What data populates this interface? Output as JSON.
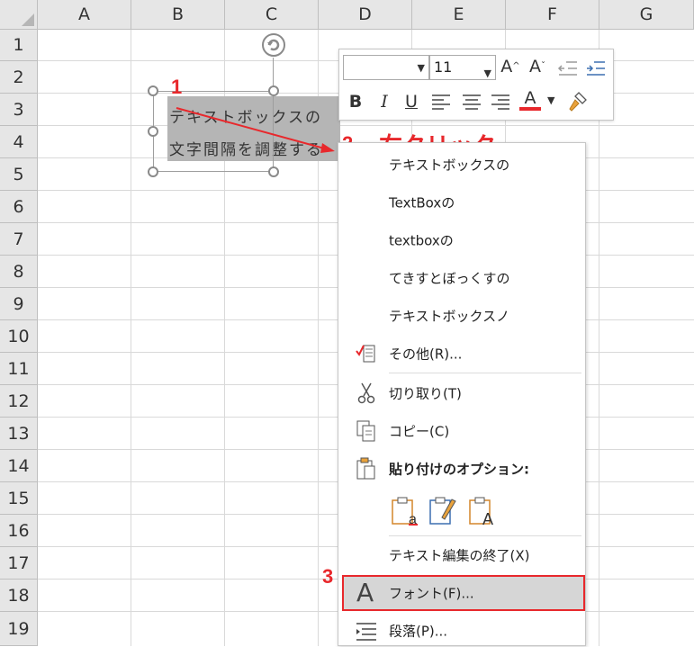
{
  "columns": [
    "A",
    "B",
    "C",
    "D",
    "E",
    "F",
    "G"
  ],
  "rows": [
    "1",
    "2",
    "3",
    "4",
    "5",
    "6",
    "7",
    "8",
    "9",
    "10",
    "11",
    "12",
    "13",
    "14",
    "15",
    "16",
    "17",
    "18",
    "19"
  ],
  "textbox": {
    "line1": "テキストボックスの",
    "line2": "文字間隔を調整する"
  },
  "mini_toolbar": {
    "font_name": "",
    "font_size": "11",
    "grow_font": "A",
    "shrink_font": "A",
    "bold": "B",
    "italic": "I",
    "underline": "U",
    "font_color": "A",
    "font_color_value": "#e8282c"
  },
  "context_menu": {
    "suggestions": [
      "テキストボックスの",
      "TextBoxの",
      "textboxの",
      "てきすとぼっくすの",
      "テキストボックスノ"
    ],
    "other": "その他(R)...",
    "cut": "切り取り(T)",
    "copy": "コピー(C)",
    "paste_options": "貼り付けのオプション:",
    "end_edit": "テキスト編集の終了(X)",
    "font": "フォント(F)...",
    "paragraph": "段落(P)..."
  },
  "annotations": {
    "step1": "1",
    "step2": "2",
    "step3": "3",
    "right_click": "右クリック",
    "accent_color": "#e8282c"
  }
}
